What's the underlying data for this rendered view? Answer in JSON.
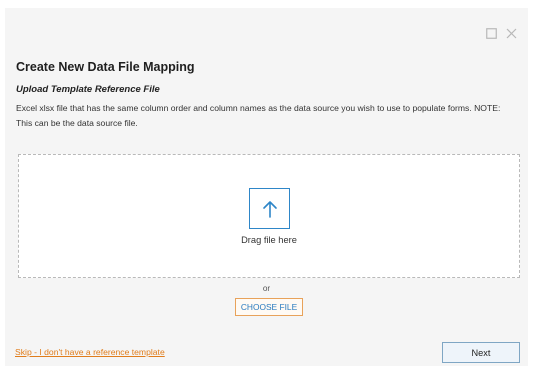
{
  "dialog": {
    "title": "Create New Data File Mapping",
    "subtitle": "Upload Template Reference File",
    "description": "Excel xlsx file that has the same column order and column names as the data source you wish to use to populate forms. NOTE: This can be the data source file.",
    "window_controls": {
      "maximize_icon": "square-outline-icon",
      "close_icon": "close-icon"
    }
  },
  "dropzone": {
    "icon": "arrow-up-icon",
    "label": "Drag file here"
  },
  "or_label": "or",
  "choose_file_label": "CHOOSE FILE",
  "footer": {
    "skip_link": "Skip - I don't have a reference template",
    "next_label": "Next"
  },
  "colors": {
    "accent_blue": "#2e86c8",
    "link_orange": "#e07d1c",
    "choose_border": "#e8a25a"
  }
}
